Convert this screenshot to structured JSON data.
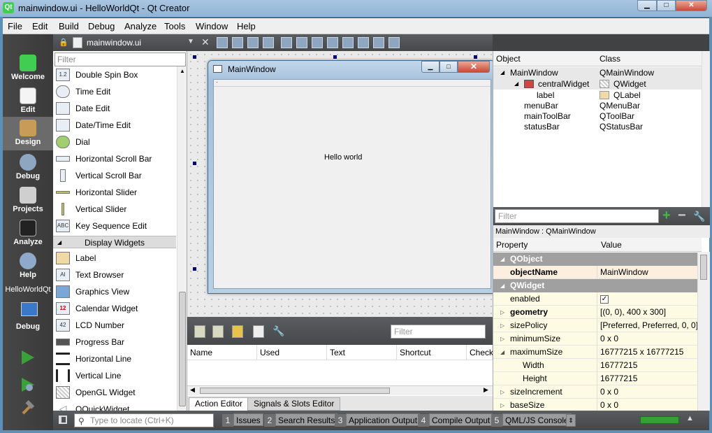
{
  "window": {
    "title": "mainwindow.ui - HelloWorldQt - Qt Creator",
    "app_icon": "Qt",
    "minimize": "▁",
    "maximize": "□",
    "close": "✕"
  },
  "menubar": [
    "File",
    "Edit",
    "Build",
    "Debug",
    "Analyze",
    "Tools",
    "Window",
    "Help"
  ],
  "modes": [
    {
      "label": "Welcome",
      "icon": "qt-logo-icon"
    },
    {
      "label": "Edit",
      "icon": "document-icon"
    },
    {
      "label": "Design",
      "icon": "pencil-ruler-icon",
      "active": true
    },
    {
      "label": "Debug",
      "icon": "bug-icon"
    },
    {
      "label": "Projects",
      "icon": "folder-icon"
    },
    {
      "label": "Analyze",
      "icon": "oscilloscope-icon"
    },
    {
      "label": "Help",
      "icon": "question-icon"
    }
  ],
  "project_target": {
    "name": "HelloWorldQt",
    "mode": "Debug"
  },
  "editor_toolbar": {
    "file": "mainwindow.ui"
  },
  "widgetbox": {
    "filter_placeholder": "Filter",
    "items_top": [
      {
        "label": "Double Spin Box",
        "icon": "1.2"
      },
      {
        "label": "Time Edit",
        "icon": "clock"
      },
      {
        "label": "Date Edit",
        "icon": "cal"
      },
      {
        "label": "Date/Time Edit",
        "icon": "cal"
      },
      {
        "label": "Dial",
        "icon": "dial"
      },
      {
        "label": "Horizontal Scroll Bar",
        "icon": "hsb"
      },
      {
        "label": "Vertical Scroll Bar",
        "icon": "vsb"
      },
      {
        "label": "Horizontal Slider",
        "icon": "hs"
      },
      {
        "label": "Vertical Slider",
        "icon": "vs"
      },
      {
        "label": "Key Sequence Edit",
        "icon": "ABC"
      }
    ],
    "category": "Display Widgets",
    "items_display": [
      {
        "label": "Label",
        "icon": "tag"
      },
      {
        "label": "Text Browser",
        "icon": "AI"
      },
      {
        "label": "Graphics View",
        "icon": "gv"
      },
      {
        "label": "Calendar Widget",
        "icon": "12"
      },
      {
        "label": "LCD Number",
        "icon": "42"
      },
      {
        "label": "Progress Bar",
        "icon": "pb"
      },
      {
        "label": "Horizontal Line",
        "icon": "hl"
      },
      {
        "label": "Vertical Line",
        "icon": "vl"
      },
      {
        "label": "OpenGL Widget",
        "icon": "gl"
      },
      {
        "label": "QQuickWidget",
        "icon": "qq"
      }
    ]
  },
  "form": {
    "title": "MainWindow",
    "label_text": "Hello world"
  },
  "action_editor": {
    "filter_placeholder": "Filter",
    "columns": [
      "Name",
      "Used",
      "Text",
      "Shortcut",
      "Check"
    ],
    "tabs": [
      "Action Editor",
      "Signals & Slots Editor"
    ]
  },
  "object_inspector": {
    "headers": [
      "Object",
      "Class"
    ],
    "rows": [
      {
        "object": "MainWindow",
        "class": "QMainWindow"
      },
      {
        "object": "centralWidget",
        "class": "QWidget"
      },
      {
        "object": "label",
        "class": "QLabel"
      },
      {
        "object": "menuBar",
        "class": "QMenuBar"
      },
      {
        "object": "mainToolBar",
        "class": "QToolBar"
      },
      {
        "object": "statusBar",
        "class": "QStatusBar"
      }
    ]
  },
  "property_editor": {
    "filter_placeholder": "Filter",
    "class_label": "MainWindow : QMainWindow",
    "headers": [
      "Property",
      "Value"
    ],
    "rows": [
      {
        "name": "QObject",
        "value": ""
      },
      {
        "name": "objectName",
        "value": "MainWindow"
      },
      {
        "name": "QWidget",
        "value": ""
      },
      {
        "name": "enabled",
        "value": "✓"
      },
      {
        "name": "geometry",
        "value": "[(0, 0), 400 x 300]"
      },
      {
        "name": "sizePolicy",
        "value": "[Preferred, Preferred, 0, 0]"
      },
      {
        "name": "minimumSize",
        "value": "0 x 0"
      },
      {
        "name": "maximumSize",
        "value": "16777215 x 16777215"
      },
      {
        "name": "Width",
        "value": "16777215"
      },
      {
        "name": "Height",
        "value": "16777215"
      },
      {
        "name": "sizeIncrement",
        "value": "0 x 0"
      },
      {
        "name": "baseSize",
        "value": "0 x 0"
      }
    ]
  },
  "statusbar": {
    "locator_placeholder": "Type to locate (Ctrl+K)",
    "tabs": [
      {
        "num": "1",
        "label": "Issues"
      },
      {
        "num": "2",
        "label": "Search Results"
      },
      {
        "num": "3",
        "label": "Application Output"
      },
      {
        "num": "4",
        "label": "Compile Output"
      },
      {
        "num": "5",
        "label": "QML/JS Console"
      }
    ],
    "build_progress": 1.0
  }
}
